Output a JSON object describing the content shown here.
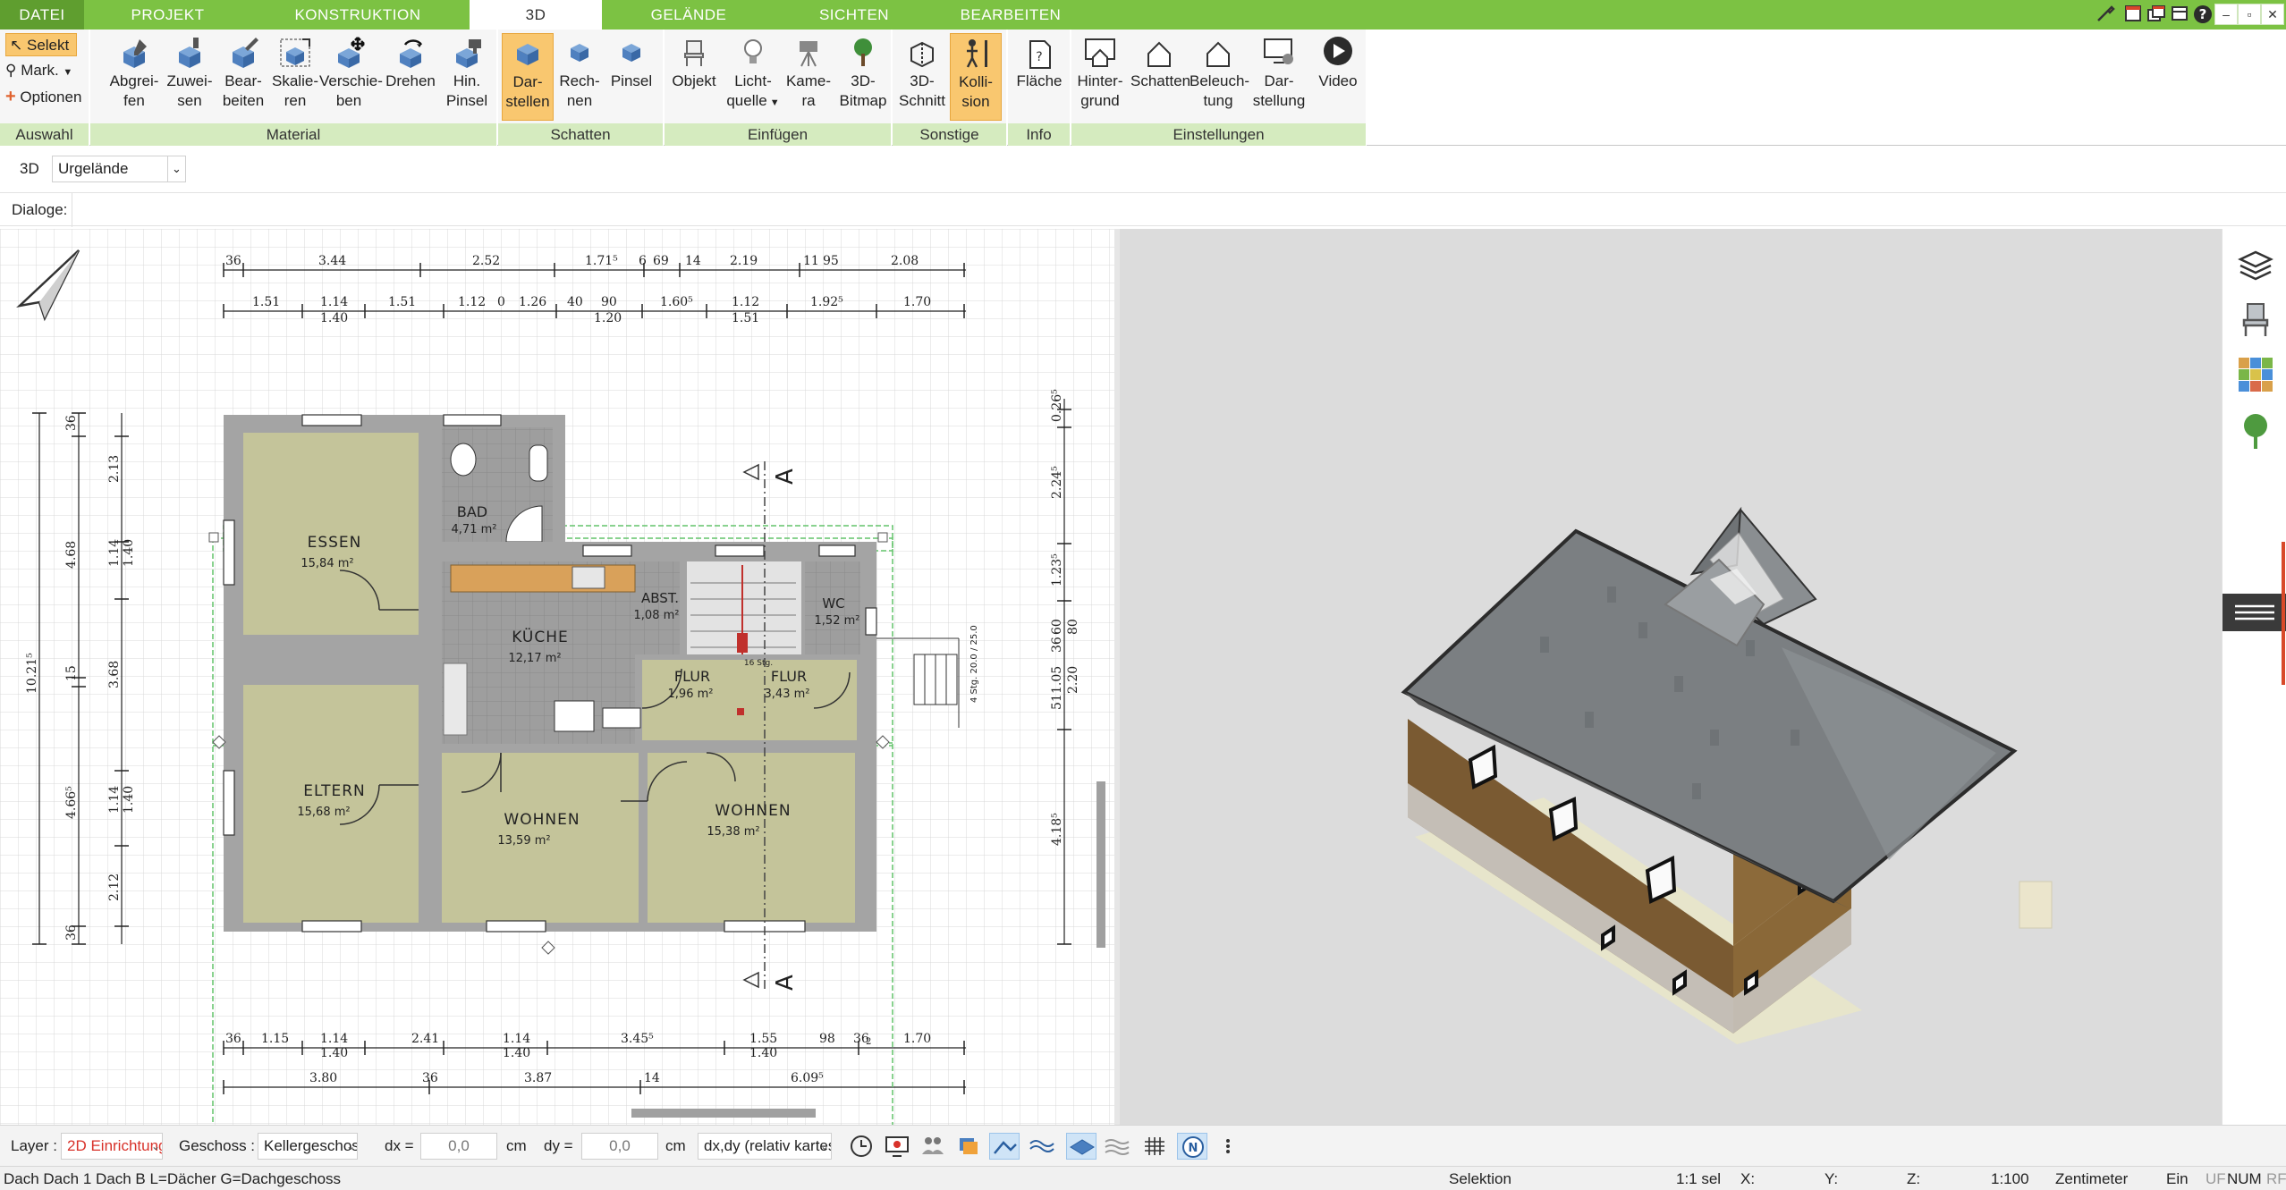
{
  "menu": {
    "tabs": [
      "DATEI",
      "PROJEKT",
      "KONSTRUKTION",
      "3D",
      "GELÄNDE",
      "SICHTEN",
      "BEARBEITEN"
    ],
    "active": "3D"
  },
  "ribbon": {
    "auswahl": {
      "title": "Auswahl",
      "selekt": "Selekt",
      "mark": "Mark.",
      "optionen": "Optionen"
    },
    "material": {
      "title": "Material",
      "buttons": [
        {
          "l1": "Abgrei-",
          "l2": "fen"
        },
        {
          "l1": "Zuwei-",
          "l2": "sen"
        },
        {
          "l1": "Bear-",
          "l2": "beiten"
        },
        {
          "l1": "Skalie-",
          "l2": "ren"
        },
        {
          "l1": "Verschie-",
          "l2": "ben"
        },
        {
          "l1": "Drehen",
          "l2": ""
        },
        {
          "l1": "Hin.",
          "l2": "Pinsel"
        }
      ]
    },
    "schatten": {
      "title": "Schatten",
      "buttons": [
        {
          "l1": "Dar-",
          "l2": "stellen"
        },
        {
          "l1": "Rech-",
          "l2": "nen"
        },
        {
          "l1": "Pinsel",
          "l2": ""
        }
      ]
    },
    "einfuegen": {
      "title": "Einfügen",
      "buttons": [
        {
          "l1": "Objekt",
          "l2": ""
        },
        {
          "l1": "Licht-",
          "l2": "quelle"
        },
        {
          "l1": "Kame-",
          "l2": "ra"
        },
        {
          "l1": "3D-",
          "l2": "Bitmap"
        }
      ]
    },
    "sonstige": {
      "title": "Sonstige",
      "buttons": [
        {
          "l1": "3D-",
          "l2": "Schnitt"
        },
        {
          "l1": "Kolli-",
          "l2": "sion"
        }
      ]
    },
    "info": {
      "title": "Info",
      "buttons": [
        {
          "l1": "Fläche",
          "l2": ""
        }
      ]
    },
    "einstellungen": {
      "title": "Einstellungen",
      "buttons": [
        {
          "l1": "Hinter-",
          "l2": "grund"
        },
        {
          "l1": "Schatten",
          "l2": ""
        },
        {
          "l1": "Beleuch-",
          "l2": "tung"
        },
        {
          "l1": "Dar-",
          "l2": "stellung"
        },
        {
          "l1": "Video",
          "l2": ""
        }
      ]
    }
  },
  "view_row": {
    "label": "3D",
    "terrain": "Urgelände"
  },
  "dialoge": {
    "label": "Dialoge:"
  },
  "plan": {
    "rooms": [
      {
        "name": "ESSEN",
        "area": "15,84 m²"
      },
      {
        "name": "BAD",
        "area": "4,71 m²"
      },
      {
        "name": "KÜCHE",
        "area": "12,17 m²"
      },
      {
        "name": "ABST.",
        "area": "1,08 m²"
      },
      {
        "name": "WC",
        "area": "1,52 m²"
      },
      {
        "name": "FLUR",
        "area": "1,96 m²"
      },
      {
        "name": "FLUR",
        "area": "3,43 m²"
      },
      {
        "name": "ELTERN",
        "area": "15,68 m²"
      },
      {
        "name": "WOHNEN",
        "area": "13,59 m²"
      },
      {
        "name": "WOHNEN",
        "area": "15,38 m²"
      }
    ],
    "stairs_label": "16 Stg.",
    "section_mark": "A",
    "dims_top_1": [
      "36",
      "3.44",
      "2.52",
      "1.71⁵",
      "6",
      "69",
      "14",
      "2.19",
      "11",
      "95",
      "2.08"
    ],
    "dims_top_2": [
      "1.51",
      "1.14",
      "1.40",
      "1.51",
      "1.12",
      "0",
      "1.26",
      "40",
      "90",
      "1.20",
      "1.60⁵",
      "1.12",
      "1.51",
      "1.92⁵",
      "1.70"
    ],
    "dims_bottom_1": [
      "36",
      "1.15",
      "1.14",
      "1.40",
      "2.41",
      "1.14",
      "1.40",
      "3.45⁵",
      "1.55",
      "1.40",
      "98",
      "36",
      "2",
      "1.70"
    ],
    "dims_bottom_2": [
      "3.80",
      "36",
      "3.87",
      "14",
      "6.09⁵"
    ],
    "dims_left_outer": [
      "10.21⁵"
    ],
    "dims_left_mid": [
      "36",
      "4.68",
      "15",
      "4.66⁵",
      "36"
    ],
    "dims_left_inner": [
      "2.13",
      "1.14",
      "1.40",
      "3.68",
      "1.14",
      "1.40",
      "2.12"
    ],
    "dims_right": [
      "0.26⁵",
      "2.24⁵",
      "1.23⁵",
      "60",
      "36",
      "80",
      "1.05",
      "51",
      "2.20",
      "4.18⁵"
    ],
    "stair_side_label": "4 Stg. 20.0 / 25.0"
  },
  "bottom": {
    "layer_label": "Layer :",
    "layer_value": "2D Einrichtung",
    "geschoss_label": "Geschoss :",
    "geschoss_value": "Kellergeschoss",
    "dx_label": "dx =",
    "dx_value": "0,0",
    "dx_unit": "cm",
    "dy_label": "dy =",
    "dy_value": "0,0",
    "dy_unit": "cm",
    "mode_value": "dx,dy (relativ kartesisch)"
  },
  "status": {
    "left": "Dach Dach 1 Dach B L=Dächer G=Dachgeschoss",
    "mode": "Selektion",
    "sel": "1:1 sel",
    "x": "X:",
    "y": "Y:",
    "z": "Z:",
    "scale": "1:100",
    "unit": "Zentimeter",
    "ein": "Ein",
    "uf": "UF",
    "num": "NUM",
    "rf": "RF"
  },
  "colors": {
    "menu_green": "#7cc243",
    "group_title_bg": "#d5ebbf",
    "room_fill": "#c4c49a",
    "wall_fill": "#a0a0a0",
    "roof": "#7b7f82",
    "brick": "#7a5a32"
  }
}
